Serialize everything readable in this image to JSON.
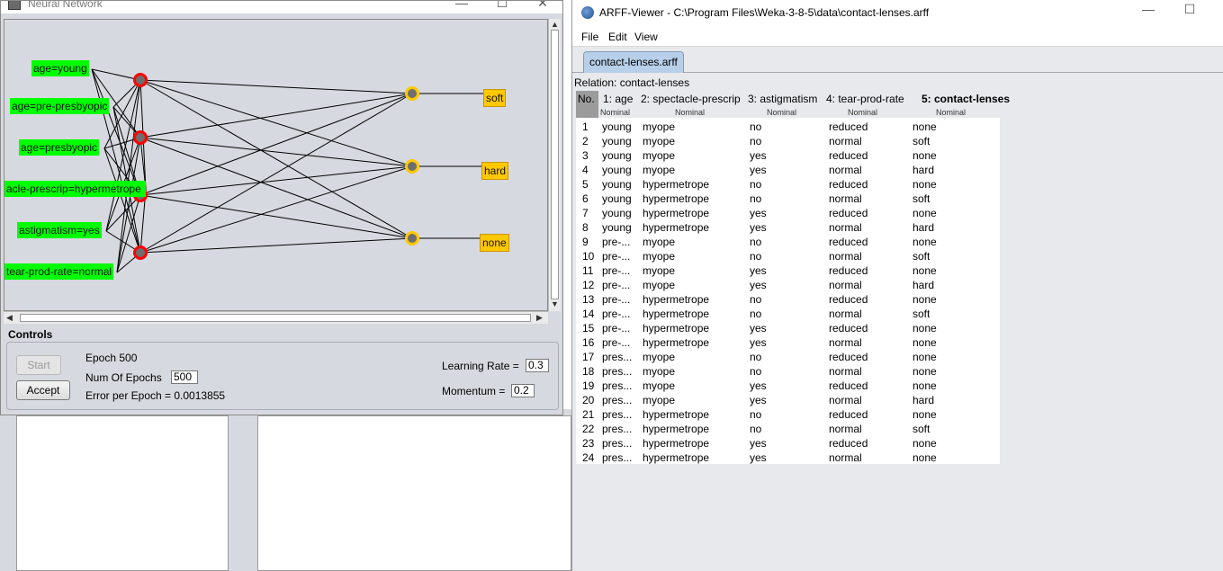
{
  "nn": {
    "title": "Neural Network",
    "input_labels": [
      "age=young",
      "age=pre-presbyopic",
      "age=presbyopic",
      "acle-prescrip=hypermetrope",
      "astigmatism=yes",
      "tear-prod-rate=normal"
    ],
    "output_labels": [
      "soft",
      "hard",
      "none"
    ],
    "controls": {
      "section_label": "Controls",
      "start_label": "Start",
      "accept_label": "Accept",
      "epoch_text": "Epoch  500",
      "num_epochs_label": "Num Of Epochs",
      "num_epochs_value": "500",
      "error_text": "Error per Epoch = 0.0013855",
      "learning_rate_label": "Learning Rate =",
      "learning_rate_value": "0.3",
      "momentum_label": "Momentum =",
      "momentum_value": "0.2"
    },
    "colors": {
      "input": "#00ff00",
      "hidden": "#ff0000",
      "output": "#ffc800"
    }
  },
  "arff": {
    "title": "ARFF-Viewer - C:\\Program Files\\Weka-3-8-5\\data\\contact-lenses.arff",
    "menu": [
      "File",
      "Edit",
      "View"
    ],
    "tab": "contact-lenses.arff",
    "relation": "Relation: contact-lenses",
    "columns": [
      {
        "name": "No.",
        "type": ""
      },
      {
        "name": "1: age",
        "type": "Nominal"
      },
      {
        "name": "2: spectacle-prescrip",
        "type": "Nominal"
      },
      {
        "name": "3: astigmatism",
        "type": "Nominal"
      },
      {
        "name": "4: tear-prod-rate",
        "type": "Nominal"
      },
      {
        "name": "5: contact-lenses",
        "type": "Nominal"
      }
    ],
    "rows": [
      [
        "1",
        "young",
        "myope",
        "no",
        "reduced",
        "none"
      ],
      [
        "2",
        "young",
        "myope",
        "no",
        "normal",
        "soft"
      ],
      [
        "3",
        "young",
        "myope",
        "yes",
        "reduced",
        "none"
      ],
      [
        "4",
        "young",
        "myope",
        "yes",
        "normal",
        "hard"
      ],
      [
        "5",
        "young",
        "hypermetrope",
        "no",
        "reduced",
        "none"
      ],
      [
        "6",
        "young",
        "hypermetrope",
        "no",
        "normal",
        "soft"
      ],
      [
        "7",
        "young",
        "hypermetrope",
        "yes",
        "reduced",
        "none"
      ],
      [
        "8",
        "young",
        "hypermetrope",
        "yes",
        "normal",
        "hard"
      ],
      [
        "9",
        "pre-...",
        "myope",
        "no",
        "reduced",
        "none"
      ],
      [
        "10",
        "pre-...",
        "myope",
        "no",
        "normal",
        "soft"
      ],
      [
        "11",
        "pre-...",
        "myope",
        "yes",
        "reduced",
        "none"
      ],
      [
        "12",
        "pre-...",
        "myope",
        "yes",
        "normal",
        "hard"
      ],
      [
        "13",
        "pre-...",
        "hypermetrope",
        "no",
        "reduced",
        "none"
      ],
      [
        "14",
        "pre-...",
        "hypermetrope",
        "no",
        "normal",
        "soft"
      ],
      [
        "15",
        "pre-...",
        "hypermetrope",
        "yes",
        "reduced",
        "none"
      ],
      [
        "16",
        "pre-...",
        "hypermetrope",
        "yes",
        "normal",
        "none"
      ],
      [
        "17",
        "pres...",
        "myope",
        "no",
        "reduced",
        "none"
      ],
      [
        "18",
        "pres...",
        "myope",
        "no",
        "normal",
        "none"
      ],
      [
        "19",
        "pres...",
        "myope",
        "yes",
        "reduced",
        "none"
      ],
      [
        "20",
        "pres...",
        "myope",
        "yes",
        "normal",
        "hard"
      ],
      [
        "21",
        "pres...",
        "hypermetrope",
        "no",
        "reduced",
        "none"
      ],
      [
        "22",
        "pres...",
        "hypermetrope",
        "no",
        "normal",
        "soft"
      ],
      [
        "23",
        "pres...",
        "hypermetrope",
        "yes",
        "reduced",
        "none"
      ],
      [
        "24",
        "pres...",
        "hypermetrope",
        "yes",
        "normal",
        "none"
      ]
    ]
  }
}
